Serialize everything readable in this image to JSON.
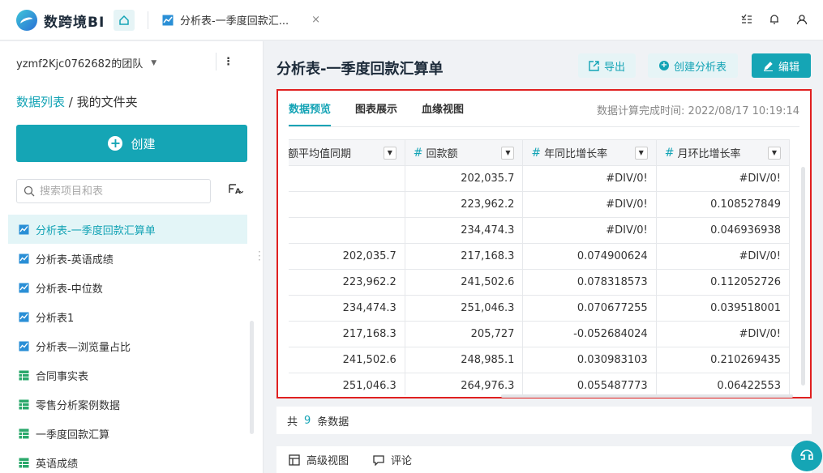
{
  "app": {
    "logo_text": "数跨境BI"
  },
  "tabs_bar": {
    "doc_tab_label": "分析表-一季度回款汇...",
    "close_glyph": "×"
  },
  "sidebar": {
    "team_name": "yzmf2Kjc0762682的团队",
    "breadcrumb_root": "数据列表",
    "breadcrumb_sep": " / ",
    "breadcrumb_current": "我的文件夹",
    "create_label": "创建",
    "search_placeholder": "搜索项目和表",
    "sort_label": "F̄A",
    "items": [
      {
        "label": "分析表-一季度回款汇算单",
        "icon": "chart-icon",
        "active": true
      },
      {
        "label": "分析表-英语成绩",
        "icon": "chart-icon"
      },
      {
        "label": "分析表-中位数",
        "icon": "chart-icon"
      },
      {
        "label": "分析表1",
        "icon": "chart-icon"
      },
      {
        "label": "分析表—浏览量占比",
        "icon": "chart-icon"
      },
      {
        "label": "合同事实表",
        "icon": "table-icon"
      },
      {
        "label": "零售分析案例数据",
        "icon": "table-icon"
      },
      {
        "label": "一季度回款汇算",
        "icon": "table-icon"
      },
      {
        "label": "英语成绩",
        "icon": "table-icon"
      }
    ]
  },
  "main": {
    "title": "分析表-一季度回款汇算单",
    "export_label": "导出",
    "create_analysis_label": "创建分析表",
    "edit_label": "编辑",
    "tabs": [
      {
        "label": "数据预览",
        "active": true
      },
      {
        "label": "图表展示"
      },
      {
        "label": "血缘视图"
      }
    ],
    "calc_time_label": "数据计算完成时间: 2022/08/17 10:19:14",
    "table": {
      "columns": [
        {
          "label": "额平均值同期",
          "type": "text"
        },
        {
          "label": "回款额",
          "type": "number"
        },
        {
          "label": "年同比增长率",
          "type": "number"
        },
        {
          "label": "月环比增长率",
          "type": "number"
        }
      ],
      "rows": [
        [
          "",
          "202,035.7",
          "#DIV/0!",
          "#DIV/0!"
        ],
        [
          "",
          "223,962.2",
          "#DIV/0!",
          "0.108527849"
        ],
        [
          "",
          "234,474.3",
          "#DIV/0!",
          "0.046936938"
        ],
        [
          "202,035.7",
          "217,168.3",
          "0.074900624",
          "#DIV/0!"
        ],
        [
          "223,962.2",
          "241,502.6",
          "0.078318573",
          "0.112052726"
        ],
        [
          "234,474.3",
          "251,046.3",
          "0.070677255",
          "0.039518001"
        ],
        [
          "217,168.3",
          "205,727",
          "-0.052684024",
          "#DIV/0!"
        ],
        [
          "241,502.6",
          "248,985.1",
          "0.030983103",
          "0.210269435"
        ],
        [
          "251,046.3",
          "264,976.3",
          "0.055487773",
          "0.06422553"
        ]
      ]
    },
    "count_prefix": "共",
    "count_value": "9",
    "count_suffix": "条数据",
    "bottom_advanced": "高级视图",
    "bottom_comment": "评论"
  },
  "colors": {
    "accent": "#15a5b5",
    "highlight_border": "#e02020"
  }
}
